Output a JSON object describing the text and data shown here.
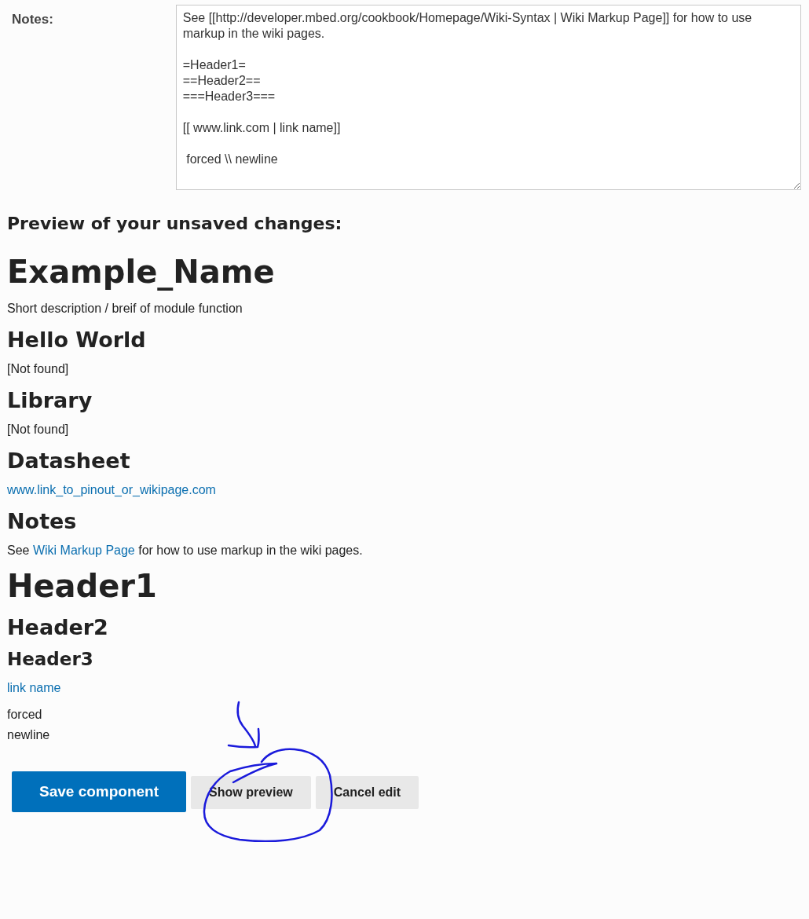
{
  "notes_field": {
    "label": "Notes:",
    "value": "See [[http://developer.mbed.org/cookbook/Homepage/Wiki-Syntax | Wiki Markup Page]] for how to use markup in the wiki pages.\n\n=Header1=\n==Header2==\n===Header3===\n\n[[ www.link.com | link name]]\n\n forced \\\\ newline\n"
  },
  "preview": {
    "heading": "Preview of your unsaved changes:",
    "blocks": [
      {
        "kind": "title",
        "text": "Example_Name"
      },
      {
        "kind": "paragraph",
        "text": "Short description / breif of module function"
      },
      {
        "kind": "heading",
        "text": "Hello World"
      },
      {
        "kind": "paragraph",
        "text": "[Not found]"
      },
      {
        "kind": "heading",
        "text": "Library"
      },
      {
        "kind": "paragraph",
        "text": "[Not found]"
      },
      {
        "kind": "heading",
        "text": "Datasheet"
      },
      {
        "kind": "link",
        "text": "www.link_to_pinout_or_wikipage.com"
      },
      {
        "kind": "heading",
        "text": "Notes"
      },
      {
        "kind": "link_sentence",
        "before": "See ",
        "link": "Wiki Markup Page",
        "after": " for how to use markup in the wiki pages."
      },
      {
        "kind": "title",
        "text": "Header1"
      },
      {
        "kind": "heading",
        "text": "Header2"
      },
      {
        "kind": "subheading",
        "text": "Header3"
      },
      {
        "kind": "link",
        "text": "link name"
      },
      {
        "kind": "lines",
        "lines": [
          "forced",
          "newline"
        ]
      }
    ]
  },
  "buttons": [
    {
      "label": "Save component",
      "kind": "primary"
    },
    {
      "label": "Show preview",
      "kind": "secondary"
    },
    {
      "label": "Cancel edit",
      "kind": "secondary"
    }
  ]
}
